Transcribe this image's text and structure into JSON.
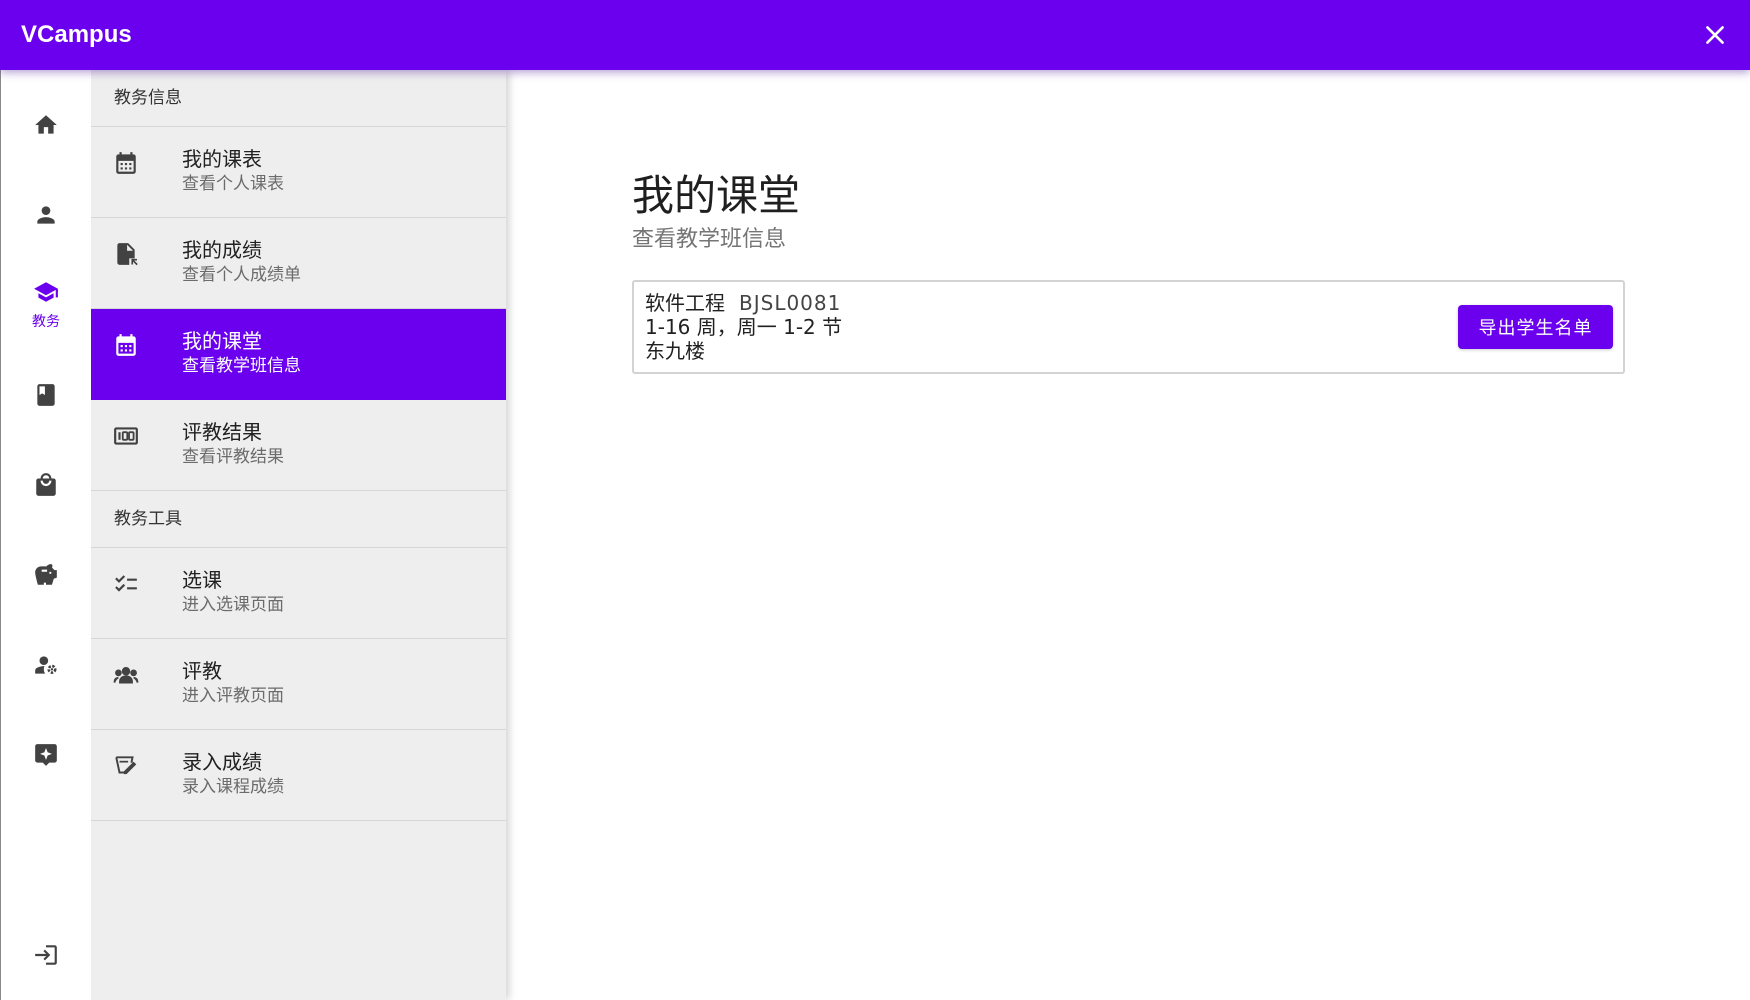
{
  "app": {
    "title": "VCampus",
    "accent_color": "#6a00ee",
    "close_icon": "close-icon"
  },
  "rail": {
    "items": [
      {
        "icon": "home-icon"
      },
      {
        "icon": "person-icon"
      },
      {
        "icon": "school-icon",
        "label": "教务",
        "active": true
      },
      {
        "icon": "book-icon"
      },
      {
        "icon": "shopping-bag-icon"
      },
      {
        "icon": "piggy-bank-icon"
      },
      {
        "icon": "manage-accounts-icon"
      },
      {
        "icon": "reviews-icon"
      }
    ],
    "exit_icon": "exit-icon"
  },
  "sidebar": {
    "sections": [
      {
        "header": "教务信息",
        "items": [
          {
            "title": "我的课表",
            "subtitle": "查看个人课表",
            "icon": "calendar-icon"
          },
          {
            "title": "我的成绩",
            "subtitle": "查看个人成绩单",
            "icon": "file-open-icon"
          },
          {
            "title": "我的课堂",
            "subtitle": "查看教学班信息",
            "icon": "calendar-icon",
            "selected": true
          },
          {
            "title": "评教结果",
            "subtitle": "查看评教结果",
            "icon": "score-100-icon"
          }
        ]
      },
      {
        "header": "教务工具",
        "items": [
          {
            "title": "选课",
            "subtitle": "进入选课页面",
            "icon": "checklist-icon"
          },
          {
            "title": "评教",
            "subtitle": "进入评教页面",
            "icon": "groups-icon"
          },
          {
            "title": "录入成绩",
            "subtitle": "录入课程成绩",
            "icon": "edit-grades-icon"
          }
        ]
      }
    ]
  },
  "main": {
    "title": "我的课堂",
    "subtitle": "查看教学班信息",
    "classes": [
      {
        "course_name": "软件工程",
        "course_code": "BJSL0081",
        "schedule": "1-16 周，周一 1-2 节",
        "location": "东九楼",
        "action_label": "导出学生名单"
      }
    ]
  }
}
